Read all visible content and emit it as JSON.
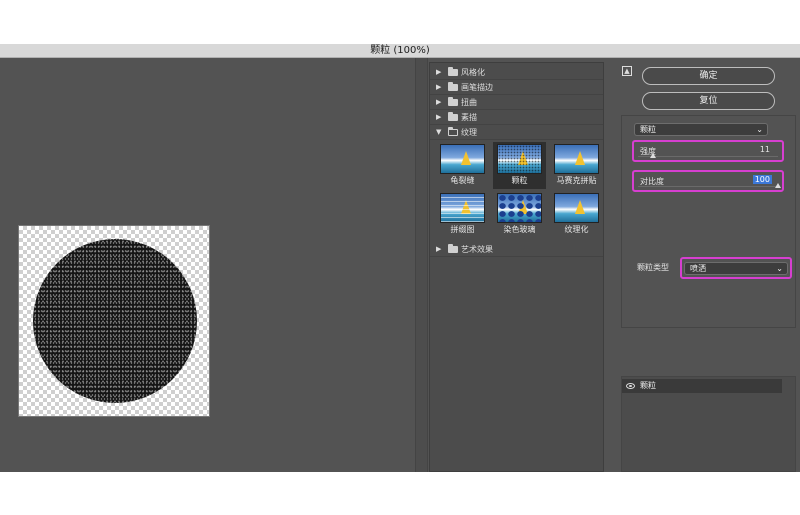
{
  "window": {
    "title": "颗粒 (100%)"
  },
  "gallery": {
    "categories_top": [
      {
        "label": "风格化",
        "expanded": false
      },
      {
        "label": "画笔描边",
        "expanded": false
      },
      {
        "label": "扭曲",
        "expanded": false
      },
      {
        "label": "素描",
        "expanded": false
      },
      {
        "label": "纹理",
        "expanded": true
      }
    ],
    "texture_filters": [
      {
        "label": "龟裂缝",
        "style": "plain",
        "selected": false
      },
      {
        "label": "颗粒",
        "style": "speck",
        "selected": true
      },
      {
        "label": "马赛克拼贴",
        "style": "plain",
        "selected": false
      },
      {
        "label": "拼缀图",
        "style": "stripe",
        "selected": false
      },
      {
        "label": "染色玻璃",
        "style": "dots",
        "selected": false
      },
      {
        "label": "纹理化",
        "style": "plain",
        "selected": false
      }
    ],
    "category_bottom": {
      "label": "艺术效果",
      "expanded": false
    }
  },
  "buttons": {
    "ok": "确定",
    "reset": "复位"
  },
  "settings": {
    "filter_select": "颗粒",
    "intensity": {
      "label": "强度",
      "value": "11",
      "fraction": 0.11
    },
    "contrast": {
      "label": "对比度",
      "value": "100",
      "fraction": 1.0
    },
    "grain_type": {
      "label": "颗粒类型",
      "value": "喷洒"
    }
  },
  "layers": {
    "active": "颗粒"
  },
  "colors": {
    "highlight_border": "#d63fd0",
    "selection": "#3c78d8"
  },
  "icons": {
    "collapse": "collapse-up-icon",
    "visibility": "eye-icon",
    "folder": "folder-icon"
  }
}
